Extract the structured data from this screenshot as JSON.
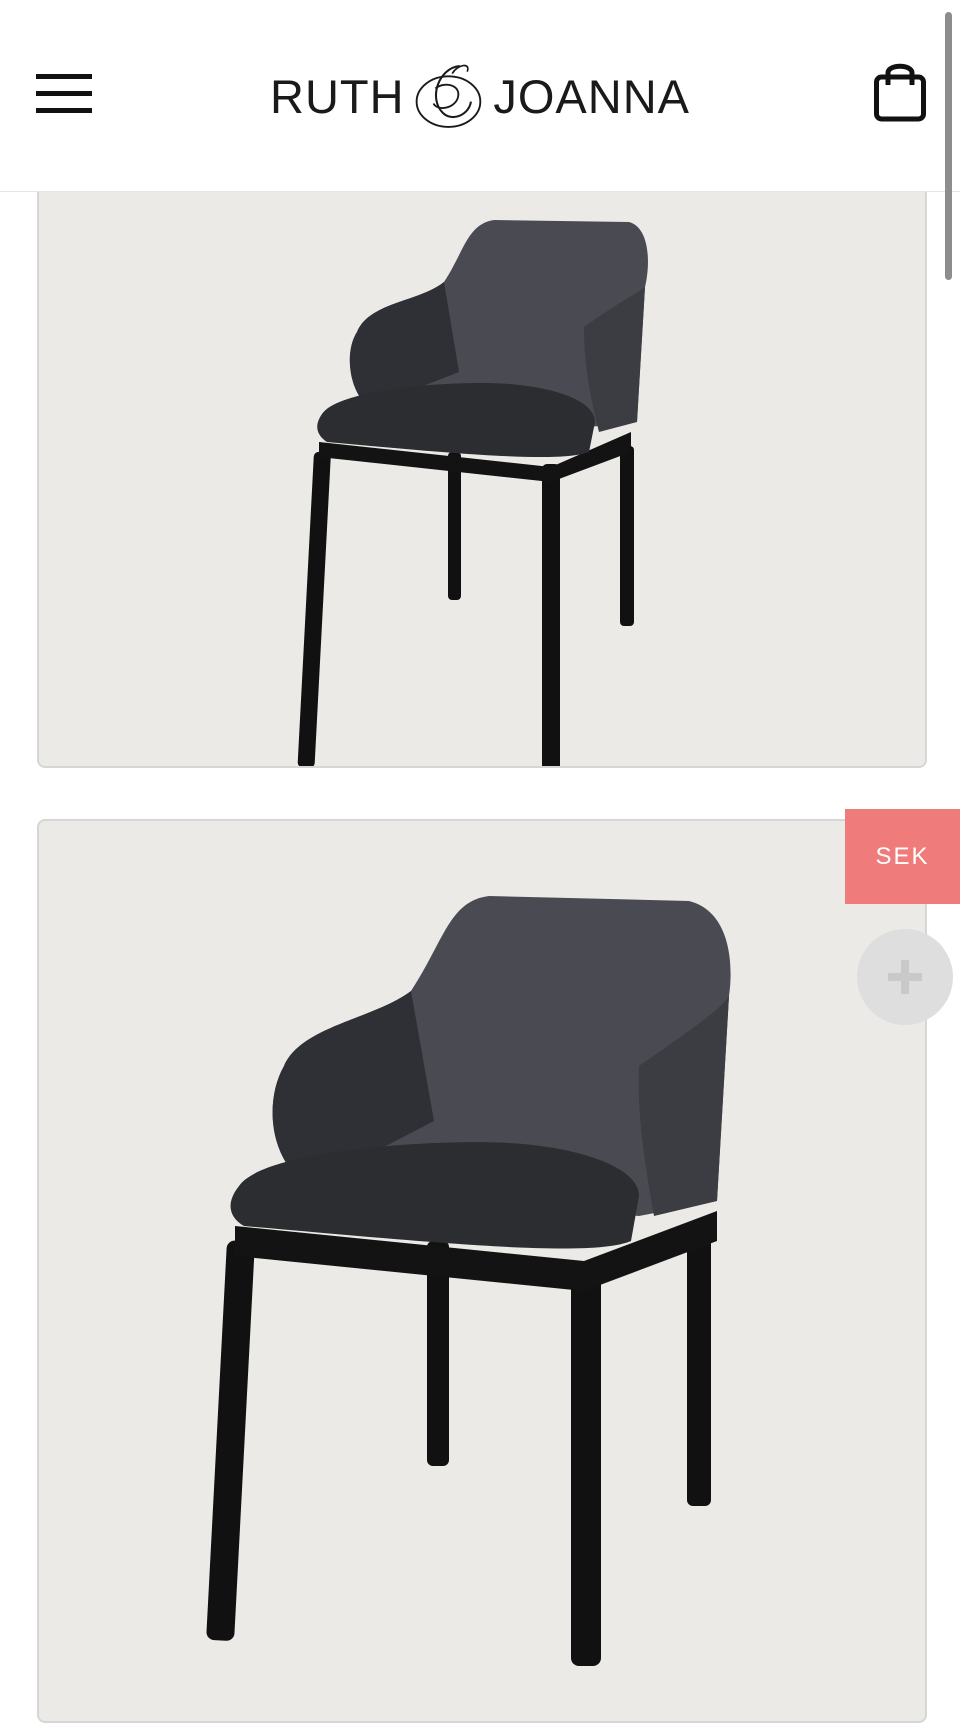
{
  "header": {
    "logo": {
      "word_left": "RUTH",
      "ampersand": "&",
      "word_right": "JOANNA"
    },
    "menu_icon": "hamburger-menu-icon",
    "cart_icon": "shopping-bag-icon"
  },
  "products": [
    {
      "image": "charcoal-upholstered-armchair-small"
    },
    {
      "image": "charcoal-upholstered-armchair-large"
    }
  ],
  "currency_tab": {
    "label": "SEK",
    "color": "#f07b7b"
  },
  "floating_action": {
    "icon": "plus-icon",
    "color": "#dedede"
  },
  "colors": {
    "card_background": "#ebeae7",
    "chair_upholstery": "#4a4b52",
    "chair_frame": "#111111"
  }
}
